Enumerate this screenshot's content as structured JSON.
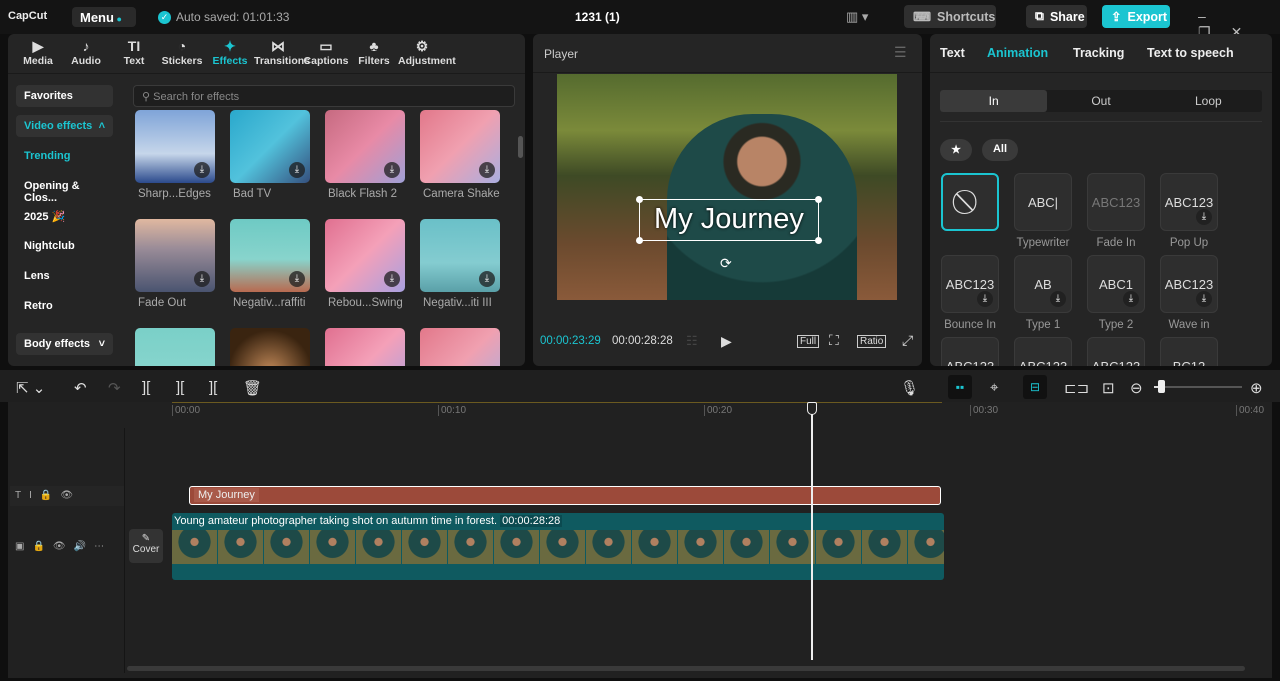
{
  "app": {
    "logo": "CapCut",
    "menu": "Menu",
    "autosave": "Auto saved: 01:01:33",
    "project_title": "1231 (1)",
    "shortcuts": "Shortcuts",
    "share": "Share",
    "export": "Export",
    "accent": "#1bc5d1"
  },
  "toolbar_tabs": [
    {
      "label": "Media",
      "icon": "▶"
    },
    {
      "label": "Audio",
      "icon": "♪"
    },
    {
      "label": "Text",
      "icon": "TI"
    },
    {
      "label": "Stickers",
      "icon": "◔"
    },
    {
      "label": "Effects",
      "icon": "✦"
    },
    {
      "label": "Transitions",
      "icon": "⋈"
    },
    {
      "label": "Captions",
      "icon": "▭"
    },
    {
      "label": "Filters",
      "icon": "♣"
    },
    {
      "label": "Adjustment",
      "icon": "⚙"
    }
  ],
  "categories": {
    "favorites": "Favorites",
    "video_effects": "Video effects",
    "items": [
      "Trending",
      "Opening & Clos...",
      "2025 🎉",
      "Nightclub",
      "Lens",
      "Retro"
    ],
    "body_effects": "Body effects"
  },
  "search": {
    "placeholder": "Search for effects"
  },
  "effects": [
    {
      "label": "Sharp...Edges",
      "bg": "linear-gradient(180deg,#7fa4d8,#c6d6ea 60%,#2b4a8c)"
    },
    {
      "label": "Bad TV",
      "bg": "linear-gradient(135deg,#2aa8cc,#52c2dc 50%,#35507e)"
    },
    {
      "label": "Black Flash 2",
      "bg": "linear-gradient(135deg,#c66a80,#e88aa6 50%,#9fa0d6)"
    },
    {
      "label": "Camera Shake",
      "bg": "linear-gradient(135deg,#e2788a,#f0a0b0 50%,#a9aee0)"
    },
    {
      "label": "Fade Out",
      "bg": "linear-gradient(180deg,#e0b8a0,#9a8c98 40%,#4a5470)"
    },
    {
      "label": "Negativ...raffiti",
      "bg": "linear-gradient(180deg,#6ecac4,#88d4cc 55%,#b86a50)"
    },
    {
      "label": "Rebou...Swing",
      "bg": "linear-gradient(135deg,#e07090,#f4a0b8 50%,#a8a0e0)"
    },
    {
      "label": "Negativ...iti III",
      "bg": "linear-gradient(180deg,#6ac0c8,#84ccd0 60%,#5aa0a8)"
    },
    {
      "label": "",
      "bg": "linear-gradient(180deg,#7ad0c8,#90d8d0)"
    },
    {
      "label": "",
      "bg": "radial-gradient(circle at 50% 60%,#c08858,#3a2410 70%)"
    },
    {
      "label": "",
      "bg": "linear-gradient(135deg,#e07090,#f4a0b8 50%,#a8a0e0)"
    },
    {
      "label": "",
      "bg": "linear-gradient(135deg,#e2788a,#f0a0b0 50%,#a9aee0)"
    }
  ],
  "player": {
    "title": "Player",
    "overlay_text": "My Journey",
    "current_time": "00:00:23:29",
    "total_time": "00:00:28:28",
    "full": "Full",
    "ratio": "Ratio"
  },
  "right_panel": {
    "tabs": [
      "Text",
      "Animation",
      "Tracking",
      "Text to speech"
    ],
    "active_tab": "Animation",
    "segments": [
      "In",
      "Out",
      "Loop"
    ],
    "active_segment": "In",
    "chip_all": "All",
    "animations": [
      {
        "label": "",
        "preview": "⃠"
      },
      {
        "label": "Typewriter",
        "preview": "ABC|"
      },
      {
        "label": "Fade In",
        "preview": "ABC123"
      },
      {
        "label": "Pop Up",
        "preview": "ABC123"
      },
      {
        "label": "Bounce In",
        "preview": "ABC123"
      },
      {
        "label": "Type 1",
        "preview": "AB"
      },
      {
        "label": "Type 2",
        "preview": "ABC1"
      },
      {
        "label": "Wave in",
        "preview": "ABC123"
      },
      {
        "label": "",
        "preview": "ABC123"
      },
      {
        "label": "",
        "preview": "ABC123"
      },
      {
        "label": "",
        "preview": "ABC123"
      },
      {
        "label": "",
        "preview": "BC12"
      }
    ]
  },
  "timeline": {
    "ruler": [
      "00:00",
      "00:10",
      "00:20",
      "00:30",
      "00:40"
    ],
    "text_clip": "My Journey",
    "video_clip": "Young amateur photographer taking shot on autumn time in forest.",
    "video_duration": "00:00:28:28",
    "cover": "Cover",
    "zoom_level": 0.06,
    "playhead_time": "00:00:23:29"
  }
}
